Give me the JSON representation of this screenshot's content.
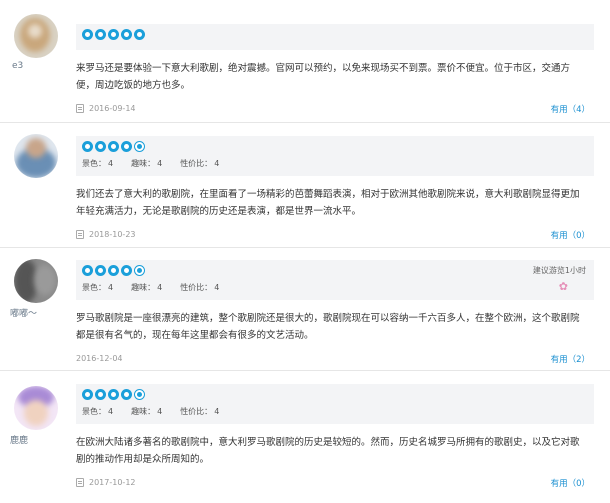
{
  "reviews": [
    {
      "user_name": "e3",
      "stars": 5,
      "sub_ratings": [],
      "text": "来罗马还是要体验一下意大利歌剧，绝对震撼。官网可以预约，以免来现场买不到票。票价不便宜。位于市区，交通方便，周边吃饭的地方也多。",
      "date": "2016-09-14",
      "useful_label": "有用",
      "useful_count": "（4）",
      "avatar_colors": [
        "#c9a77c",
        "#d9d2c4"
      ]
    },
    {
      "user_name": "",
      "stars": 4,
      "sub_ratings": [
        {
          "label": "景色：",
          "value": "4"
        },
        {
          "label": "趣味：",
          "value": "4"
        },
        {
          "label": "性价比：",
          "value": "4"
        }
      ],
      "text": "我们还去了意大利的歌剧院，在里面看了一场精彩的芭蕾舞蹈表演，相对于欧洲其他歌剧院来说，意大利歌剧院显得更加年轻充满活力，无论是歌剧院的历史还是表演，都是世界一流水平。",
      "date": "2018-10-23",
      "useful_label": "有用",
      "useful_count": "（0）",
      "avatar_colors": [
        "#6a8fb5",
        "#c8a58a"
      ]
    },
    {
      "user_name": "嘟嘟～",
      "stars": 4,
      "sub_ratings": [
        {
          "label": "景色：",
          "value": "4"
        },
        {
          "label": "趣味：",
          "value": "4"
        },
        {
          "label": "性价比：",
          "value": "4"
        }
      ],
      "recommend": "建议游览1小时",
      "text": "罗马歌剧院是一座很漂亮的建筑，整个歌剧院还是很大的，歌剧院现在可以容纳一千六百多人，在整个欧洲，这个歌剧院都是很有名气的，现在每年这里都会有很多的文艺活动。",
      "date": "2016-12-04",
      "useful_label": "有用",
      "useful_count": "（2）",
      "avatar_colors": [
        "#555555",
        "#9a9a9a"
      ]
    },
    {
      "user_name": "鹿鹿",
      "stars": 4,
      "sub_ratings": [
        {
          "label": "景色：",
          "value": "4"
        },
        {
          "label": "趣味：",
          "value": "4"
        },
        {
          "label": "性价比：",
          "value": "4"
        }
      ],
      "text": "在欧洲大陆诸多著名的歌剧院中，意大利罗马歌剧院的历史是较短的。然而，历史名城罗马所拥有的歌剧史，以及它对歌剧的推动作用却是众所周知的。",
      "date": "2017-10-12",
      "useful_label": "有用",
      "useful_count": "（0）",
      "avatar_colors": [
        "#a98bd6",
        "#f0d2c0"
      ]
    }
  ]
}
